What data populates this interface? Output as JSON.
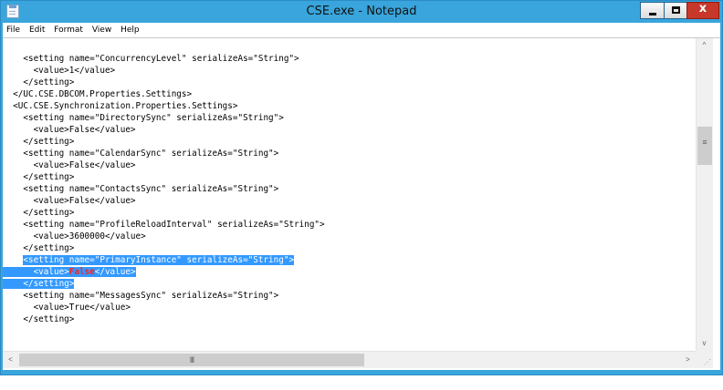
{
  "window": {
    "title": "CSE.exe - Notepad",
    "accent_color": "#39a5dc",
    "close_color": "#c7382a",
    "close_glyph": "x"
  },
  "menu": {
    "items": [
      "File",
      "Edit",
      "Format",
      "View",
      "Help"
    ]
  },
  "editor": {
    "selection_color": "#3399ff",
    "lines": [
      [
        {
          "text": "    <setting name=\"ConcurrencyLevel\" serializeAs=\"String\">",
          "style": ""
        }
      ],
      [
        {
          "text": "      <value>1</value>",
          "style": ""
        }
      ],
      [
        {
          "text": "    </setting>",
          "style": ""
        }
      ],
      [
        {
          "text": "  </UC.CSE.DBCOM.Properties.Settings>",
          "style": ""
        }
      ],
      [
        {
          "text": "  <UC.CSE.Synchronization.Properties.Settings>",
          "style": ""
        }
      ],
      [
        {
          "text": "    <setting name=\"DirectorySync\" serializeAs=\"String\">",
          "style": ""
        }
      ],
      [
        {
          "text": "      <value>False</value>",
          "style": ""
        }
      ],
      [
        {
          "text": "    </setting>",
          "style": ""
        }
      ],
      [
        {
          "text": "    <setting name=\"CalendarSync\" serializeAs=\"String\">",
          "style": ""
        }
      ],
      [
        {
          "text": "      <value>False</value>",
          "style": ""
        }
      ],
      [
        {
          "text": "    </setting>",
          "style": ""
        }
      ],
      [
        {
          "text": "    <setting name=\"ContactsSync\" serializeAs=\"String\">",
          "style": ""
        }
      ],
      [
        {
          "text": "      <value>False</value>",
          "style": ""
        }
      ],
      [
        {
          "text": "    </setting>",
          "style": ""
        }
      ],
      [
        {
          "text": "    <setting name=\"ProfileReloadInterval\" serializeAs=\"String\">",
          "style": ""
        }
      ],
      [
        {
          "text": "      <value>3600000</value>",
          "style": ""
        }
      ],
      [
        {
          "text": "    </setting>",
          "style": ""
        }
      ],
      [
        {
          "text": "    ",
          "style": ""
        },
        {
          "text": "<setting name=\"PrimaryInstance\" serializeAs=\"String\">",
          "style": "sel"
        }
      ],
      [
        {
          "text": "      <value>",
          "style": "sel"
        },
        {
          "text": "False",
          "style": "sel-red"
        },
        {
          "text": "</value>",
          "style": "sel"
        }
      ],
      [
        {
          "text": "    </setting>",
          "style": "sel"
        }
      ],
      [
        {
          "text": "    <setting name=\"MessagesSync\" serializeAs=\"String\">",
          "style": ""
        }
      ],
      [
        {
          "text": "      <value>True</value>",
          "style": ""
        }
      ],
      [
        {
          "text": "    </setting>",
          "style": ""
        }
      ]
    ]
  },
  "scrollbars": {
    "up_arrow": "^",
    "down_arrow": "v",
    "left_arrow": "<",
    "right_arrow": ">",
    "vgrip": "≡",
    "hgrip": "III",
    "vertical_position": 0.3,
    "horizontal_position": 0.0
  }
}
